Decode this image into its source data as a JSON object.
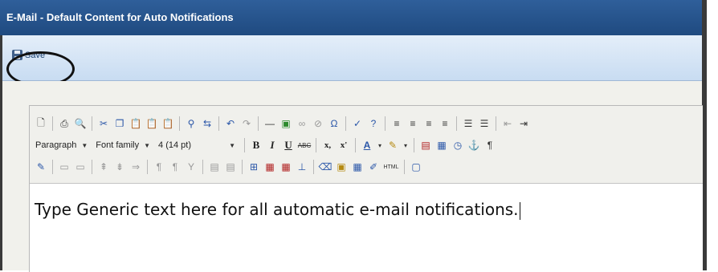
{
  "window": {
    "title": "E-Mail - Default Content for Auto Notifications"
  },
  "actions": {
    "save_label": "Save"
  },
  "toolbar": {
    "format_select": "Paragraph",
    "font_select": "Font family",
    "size_select": "4 (14 pt)",
    "bold": "B",
    "italic": "I",
    "underline": "U",
    "strike": "ABC",
    "subscript": "x,",
    "superscript": "x'",
    "html": "HTML"
  },
  "editor": {
    "body_text": "Type Generic text here for all automatic e-mail notifications."
  },
  "colors": {
    "title_bar": "#2f5f9a",
    "action_bar": "#d6e5f5",
    "editor_bg": "#f0f0ec"
  }
}
